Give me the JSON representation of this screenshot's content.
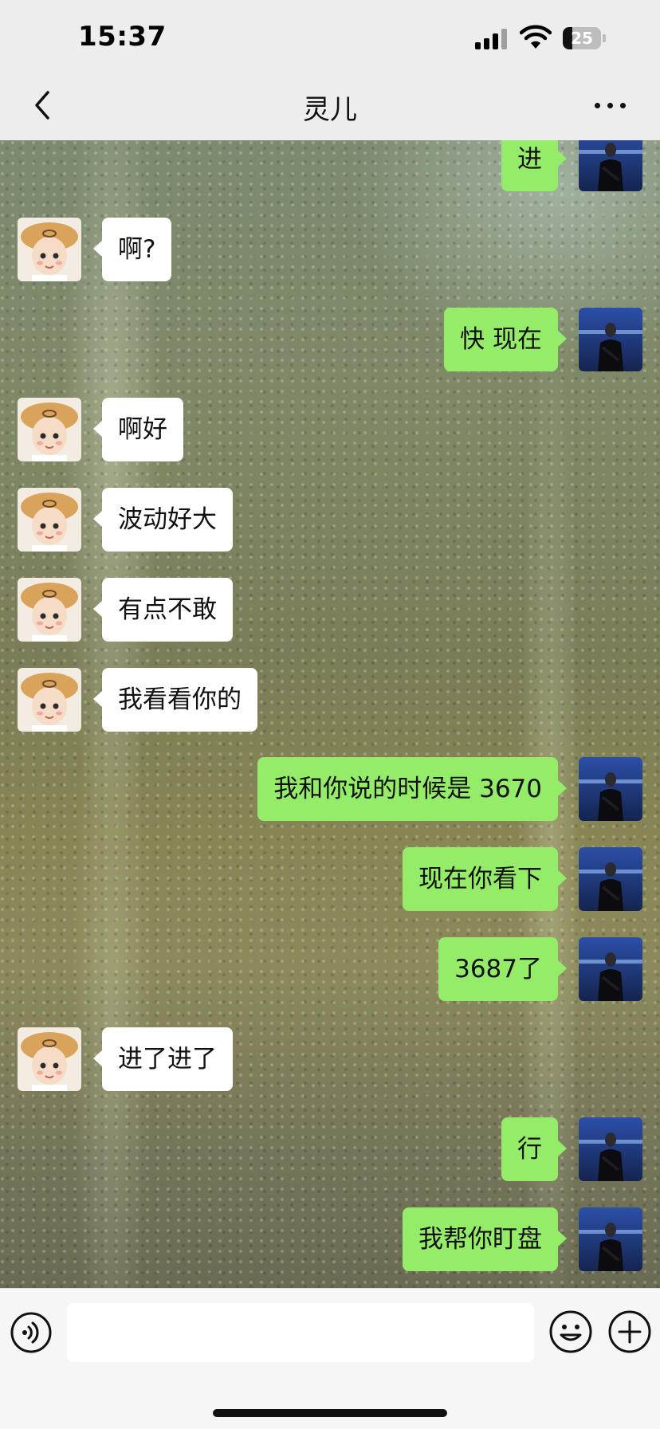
{
  "status_bar": {
    "time": "15:37",
    "battery_level": "25",
    "battery_fraction": 0.25
  },
  "nav": {
    "title": "灵儿",
    "back_icon": "chevron-left-icon",
    "more_icon": "more-dots-icon"
  },
  "colors": {
    "outgoing_bubble": "#95ec69",
    "incoming_bubble": "#ffffff",
    "bar_background": "#ededed"
  },
  "messages": [
    {
      "side": "out",
      "text": "进"
    },
    {
      "side": "in",
      "text": "啊?"
    },
    {
      "side": "out",
      "text": "快 现在"
    },
    {
      "side": "in",
      "text": "啊好"
    },
    {
      "side": "in",
      "text": "波动好大"
    },
    {
      "side": "in",
      "text": "有点不敢"
    },
    {
      "side": "in",
      "text": "我看看你的"
    },
    {
      "side": "out",
      "text": "我和你说的时候是 3670"
    },
    {
      "side": "out",
      "text": "现在你看下"
    },
    {
      "side": "out",
      "text": "3687了"
    },
    {
      "side": "in",
      "text": "进了进了"
    },
    {
      "side": "out",
      "text": "行"
    },
    {
      "side": "out",
      "text": "我帮你盯盘"
    }
  ],
  "input_bar": {
    "placeholder": "",
    "voice_icon": "voice-icon",
    "emoji_icon": "emoji-icon",
    "add_icon": "add-icon"
  }
}
